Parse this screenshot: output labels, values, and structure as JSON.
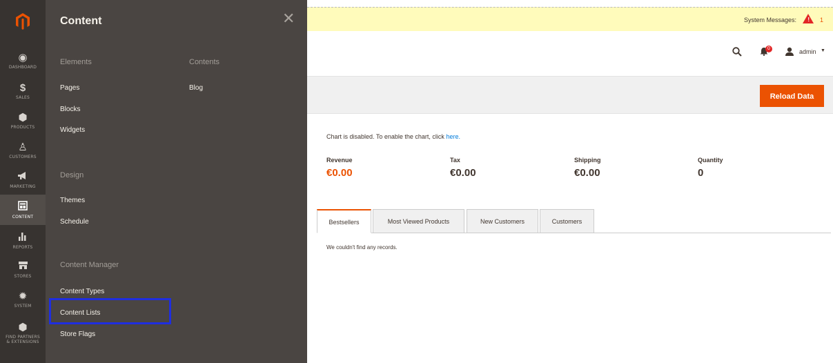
{
  "colors": {
    "rail_bg": "#373330",
    "flyout_bg": "#4a4542",
    "accent": "#eb5202",
    "highlight_border": "#1f2ee0",
    "system_bar": "#fffbbb"
  },
  "rail": {
    "items": [
      {
        "label": "DASHBOARD",
        "icon": "dashboard-icon",
        "glyph": "◉"
      },
      {
        "label": "SALES",
        "icon": "dollar-icon",
        "glyph": "$"
      },
      {
        "label": "PRODUCTS",
        "icon": "cube-icon",
        "glyph": "⬢"
      },
      {
        "label": "CUSTOMERS",
        "icon": "person-icon",
        "glyph": "♙"
      },
      {
        "label": "MARKETING",
        "icon": "megaphone-icon",
        "glyph": "📢"
      },
      {
        "label": "CONTENT",
        "icon": "content-icon",
        "glyph": "▦"
      },
      {
        "label": "REPORTS",
        "icon": "bar-chart-icon",
        "glyph": "ıl"
      },
      {
        "label": "STORES",
        "icon": "store-icon",
        "glyph": "⌂"
      },
      {
        "label": "SYSTEM",
        "icon": "gear-icon",
        "glyph": "✹"
      },
      {
        "label": "FIND PARTNERS & EXTENSIONS",
        "icon": "partners-icon",
        "glyph": "⬢"
      }
    ]
  },
  "flyout": {
    "title": "Content",
    "sections": {
      "elements": {
        "title": "Elements",
        "links": [
          "Pages",
          "Blocks",
          "Widgets"
        ]
      },
      "contents": {
        "title": "Contents",
        "links": [
          "Blog"
        ]
      },
      "design": {
        "title": "Design",
        "links": [
          "Themes",
          "Schedule"
        ]
      },
      "content_manager": {
        "title": "Content Manager",
        "links": [
          "Content Types",
          "Content Lists",
          "Store Flags"
        ]
      }
    }
  },
  "header": {
    "system_messages_label": "System Messages:",
    "system_messages_count": "1",
    "notifications_count": "0",
    "user_label": "admin"
  },
  "page_actions": {
    "reload_label": "Reload Data"
  },
  "dashboard": {
    "chart_note": "Chart is disabled. To enable the chart, click",
    "chart_note_link": "here.",
    "stats": [
      {
        "label": "Revenue",
        "value": "€0.00"
      },
      {
        "label": "Tax",
        "value": "€0.00"
      },
      {
        "label": "Shipping",
        "value": "€0.00"
      },
      {
        "label": "Quantity",
        "value": "0"
      }
    ],
    "tabs": [
      "Bestsellers",
      "Most Viewed Products",
      "New Customers",
      "Customers"
    ],
    "empty_message": "We couldn't find any records."
  }
}
